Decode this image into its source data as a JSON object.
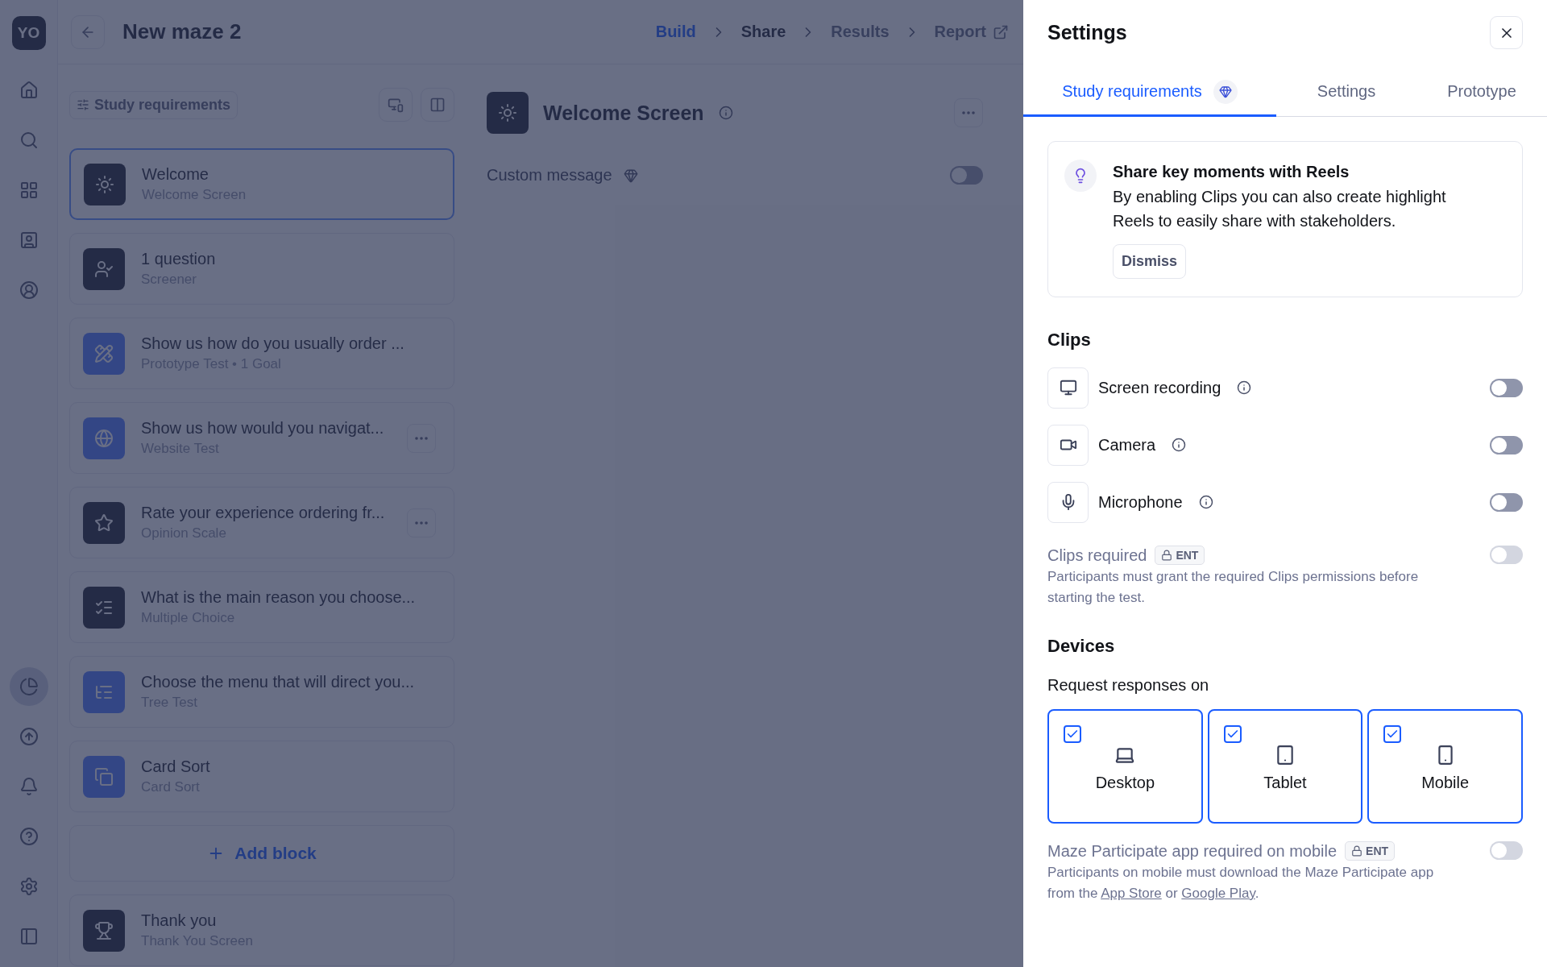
{
  "rail": {
    "avatar": "YO",
    "top_items": [
      {
        "selected": false
      },
      {
        "selected": false
      },
      {
        "selected": false
      },
      {
        "selected": false
      },
      {
        "selected": false
      }
    ],
    "bottom_items": [
      {
        "selected": true
      },
      {
        "selected": false
      },
      {
        "selected": false
      },
      {
        "selected": false
      },
      {
        "selected": false
      },
      {
        "selected": false
      }
    ]
  },
  "header": {
    "title": "New maze 2",
    "steps": [
      {
        "label": "Build",
        "selected": true,
        "disabled": false
      },
      {
        "label": "Share",
        "selected": false,
        "disabled": false
      },
      {
        "label": "Results",
        "selected": false,
        "disabled": true
      },
      {
        "label": "Report",
        "selected": false,
        "disabled": true
      }
    ]
  },
  "blocks_panel": {
    "title": "Study requirements",
    "blocks": [
      {
        "kind": "welcome",
        "title": "Welcome",
        "subtitle": "Welcome Screen",
        "selected": true,
        "menu": false
      },
      {
        "kind": "screener",
        "title": "1 question",
        "subtitle": "Screener",
        "selected": false,
        "menu": false
      },
      {
        "kind": "prototype",
        "title": "Show us how do you usually order ...",
        "subtitle": "Prototype Test • 1 Goal",
        "selected": false,
        "menu": false
      },
      {
        "kind": "website",
        "title": "Show us how would you navigat...",
        "subtitle": "Website Test",
        "selected": false,
        "menu": true
      },
      {
        "kind": "opinion",
        "title": "Rate your experience ordering fr...",
        "subtitle": "Opinion Scale",
        "selected": false,
        "menu": true
      },
      {
        "kind": "choice",
        "title": "What is the main reason you choose...",
        "subtitle": "Multiple Choice",
        "selected": false,
        "menu": false
      },
      {
        "kind": "tree",
        "title": "Choose the menu that will direct you...",
        "subtitle": "Tree Test",
        "selected": false,
        "menu": false
      },
      {
        "kind": "cardsort",
        "title": "Card Sort",
        "subtitle": "Card Sort",
        "selected": false,
        "menu": false
      }
    ],
    "add_label": "Add block",
    "end_block": {
      "kind": "thankyou",
      "title": "Thank you",
      "subtitle": "Thank You Screen",
      "selected": false,
      "menu": false
    }
  },
  "editor": {
    "title": "Welcome Screen",
    "custom_message": {
      "label": "Custom message",
      "on": false
    }
  },
  "settings_panel": {
    "title": "Settings",
    "tabs": [
      {
        "label": "Study requirements",
        "selected": true,
        "premium": true
      },
      {
        "label": "Settings",
        "selected": false,
        "premium": false
      },
      {
        "label": "Prototype",
        "selected": false,
        "premium": false
      }
    ],
    "tip": {
      "title": "Share key moments with Reels",
      "body": "By enabling Clips you can also create highlight Reels to easily share with stakeholders.",
      "action": "Dismiss"
    },
    "clips": {
      "heading": "Clips",
      "items": [
        {
          "kind": "screen",
          "label": "Screen recording",
          "on": false
        },
        {
          "kind": "camera",
          "label": "Camera",
          "on": false
        },
        {
          "kind": "microphone",
          "label": "Microphone",
          "on": false
        }
      ],
      "required": {
        "label": "Clips required",
        "badge": "ENT",
        "on": false,
        "disabled": true,
        "description": "Participants must grant the required Clips permissions before starting the test."
      }
    },
    "devices": {
      "heading": "Devices",
      "prompt": "Request responses on",
      "options": [
        {
          "kind": "desktop",
          "label": "Desktop",
          "checked": true
        },
        {
          "kind": "tablet",
          "label": "Tablet",
          "checked": true
        },
        {
          "kind": "mobile",
          "label": "Mobile",
          "checked": true
        }
      ],
      "app_required": {
        "label": "Maze Participate app required on mobile",
        "badge": "ENT",
        "on": false,
        "disabled": true,
        "description": [
          {
            "text": "Participants on mobile must download the Maze Participate app from the ",
            "link": false
          },
          {
            "text": "App Store",
            "link": true
          },
          {
            "text": " or ",
            "link": false
          },
          {
            "text": "Google Play",
            "link": true
          },
          {
            "text": ".",
            "link": false
          }
        ]
      }
    }
  }
}
